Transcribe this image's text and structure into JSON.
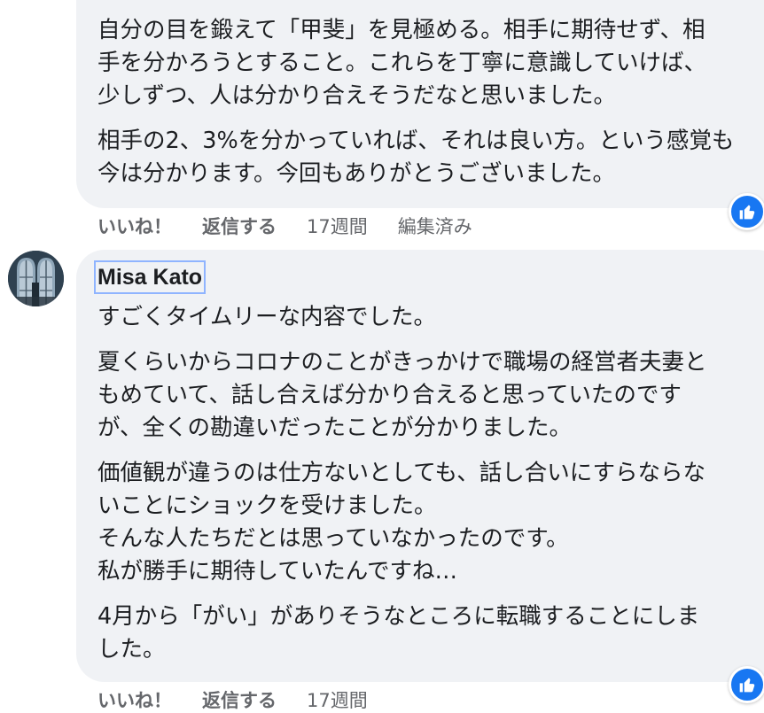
{
  "comment1": {
    "paragraphs": [
      [
        "自分の目を鍛えて「甲斐」を見極める。相手に期待せず、相",
        "手を分かろうとすること。これらを丁寧に意識していけば、",
        "少しずつ、人は分かり合えそうだなと思いました。"
      ],
      [
        "相手の2、3%を分かっていれば、それは良い方。という感覚も",
        "今は分かります。今回もありがとうございました。"
      ]
    ],
    "actions": {
      "like": "いいね！",
      "reply": "返信する",
      "time": "17週間",
      "edited": "編集済み"
    },
    "reaction_icon": "like-thumb-icon"
  },
  "comment2": {
    "author": "Misa Kato",
    "avatar_icon": "stained-glass-avatar",
    "paragraphs": [
      [
        "すごくタイムリーな内容でした。"
      ],
      [
        "夏くらいからコロナのことがきっかけで職場の経営者夫妻と",
        "もめていて、話し合えば分かり合えると思っていたのです",
        "が、全くの勘違いだったことが分かりました。"
      ],
      [
        "価値観が違うのは仕方ないとしても、話し合いにすらならな",
        "いことにショックを受けました。",
        "そんな人たちだとは思っていなかったのです。",
        "私が勝手に期待していたんですね…"
      ],
      [
        "4月から「がい」がありそうなところに転職することにしま",
        "した。"
      ]
    ],
    "actions": {
      "like": "いいね！",
      "reply": "返信する",
      "time": "17週間"
    },
    "reaction_icon": "like-thumb-icon"
  },
  "colors": {
    "bubble": "#f0f2f5",
    "meta_text": "#65676b",
    "like_blue": "#1877f2",
    "author_outline": "#8fb4ff"
  }
}
